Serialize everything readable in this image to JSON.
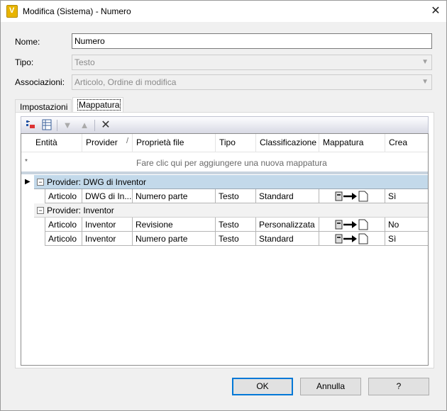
{
  "window": {
    "title": "Modifica (Sistema) - Numero",
    "app_icon_letter": "V",
    "close_glyph": "✕"
  },
  "form": {
    "name_label": "Nome:",
    "name_value": "Numero",
    "type_label": "Tipo:",
    "type_value": "Testo",
    "assoc_label": "Associazioni:",
    "assoc_value": "Articolo, Ordine di modifica"
  },
  "tabs": [
    {
      "label": "Impostazioni",
      "active": false
    },
    {
      "label": "Mappatura",
      "active": true
    }
  ],
  "toolbar": {
    "icons": [
      "mapping-add-icon",
      "grid-columns-icon",
      "move-down-icon",
      "move-up-icon",
      "delete-icon"
    ],
    "delete_glyph": "✕"
  },
  "grid": {
    "columns": [
      "Entità",
      "Provider",
      "Proprietà file",
      "Tipo",
      "Classificazione",
      "Mappatura",
      "Crea"
    ],
    "sort_indicator": "/",
    "new_row_marker": "*",
    "new_row_text": "Fare clic qui per aggiungere una nuova mappatura",
    "groups": [
      {
        "label": "Provider: DWG di Inventor",
        "selected": true,
        "rows": [
          {
            "entity": "Articolo",
            "provider": "DWG di In...",
            "property": "Numero parte",
            "type": "Testo",
            "classification": "Standard",
            "mapping": "file-to-property-icon",
            "create": "Sì"
          }
        ]
      },
      {
        "label": "Provider: Inventor",
        "selected": false,
        "rows": [
          {
            "entity": "Articolo",
            "provider": "Inventor",
            "property": "Revisione",
            "type": "Testo",
            "classification": "Personalizzata",
            "mapping": "file-to-property-icon",
            "create": "No"
          },
          {
            "entity": "Articolo",
            "provider": "Inventor",
            "property": "Numero parte",
            "type": "Testo",
            "classification": "Standard",
            "mapping": "file-to-property-icon",
            "create": "Sì"
          }
        ]
      }
    ]
  },
  "buttons": {
    "ok": "OK",
    "cancel": "Annulla",
    "help": "?"
  }
}
